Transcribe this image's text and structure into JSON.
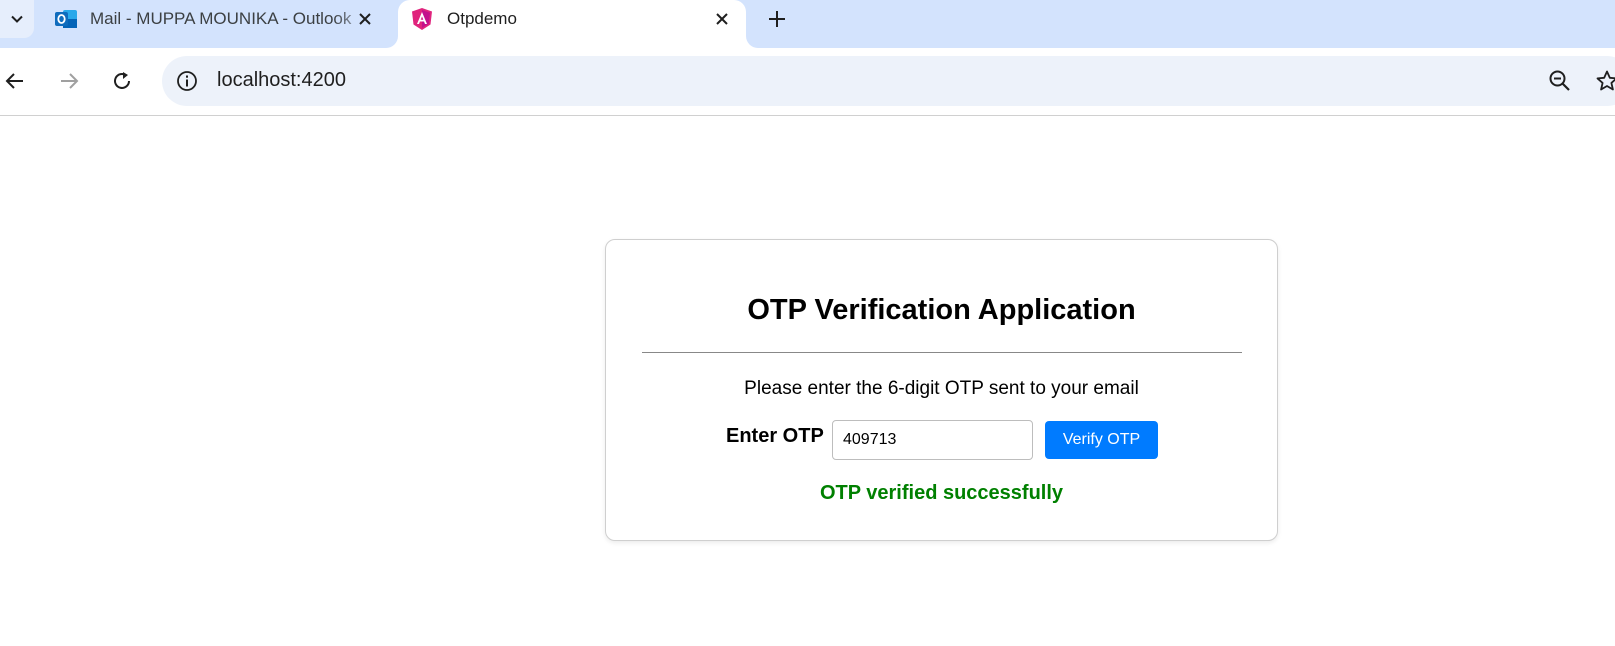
{
  "browser": {
    "tabs": [
      {
        "title": "Mail - MUPPA MOUNIKA - Outlook",
        "icon": "outlook-icon",
        "active": false
      },
      {
        "title": "Otpdemo",
        "icon": "angular-icon",
        "active": true
      }
    ],
    "address": {
      "url": "localhost:4200"
    },
    "colors": {
      "tabstrip": "#d3e3fd",
      "omnibox": "#edf2fa"
    }
  },
  "page": {
    "title": "OTP Verification Application",
    "instructions": "Please enter the 6-digit OTP sent to your email",
    "otp_label": "Enter OTP",
    "otp_value": "409713",
    "verify_label": "Verify OTP",
    "status": "OTP verified successfully",
    "colors": {
      "button": "#007bff",
      "status": "#008000"
    }
  }
}
